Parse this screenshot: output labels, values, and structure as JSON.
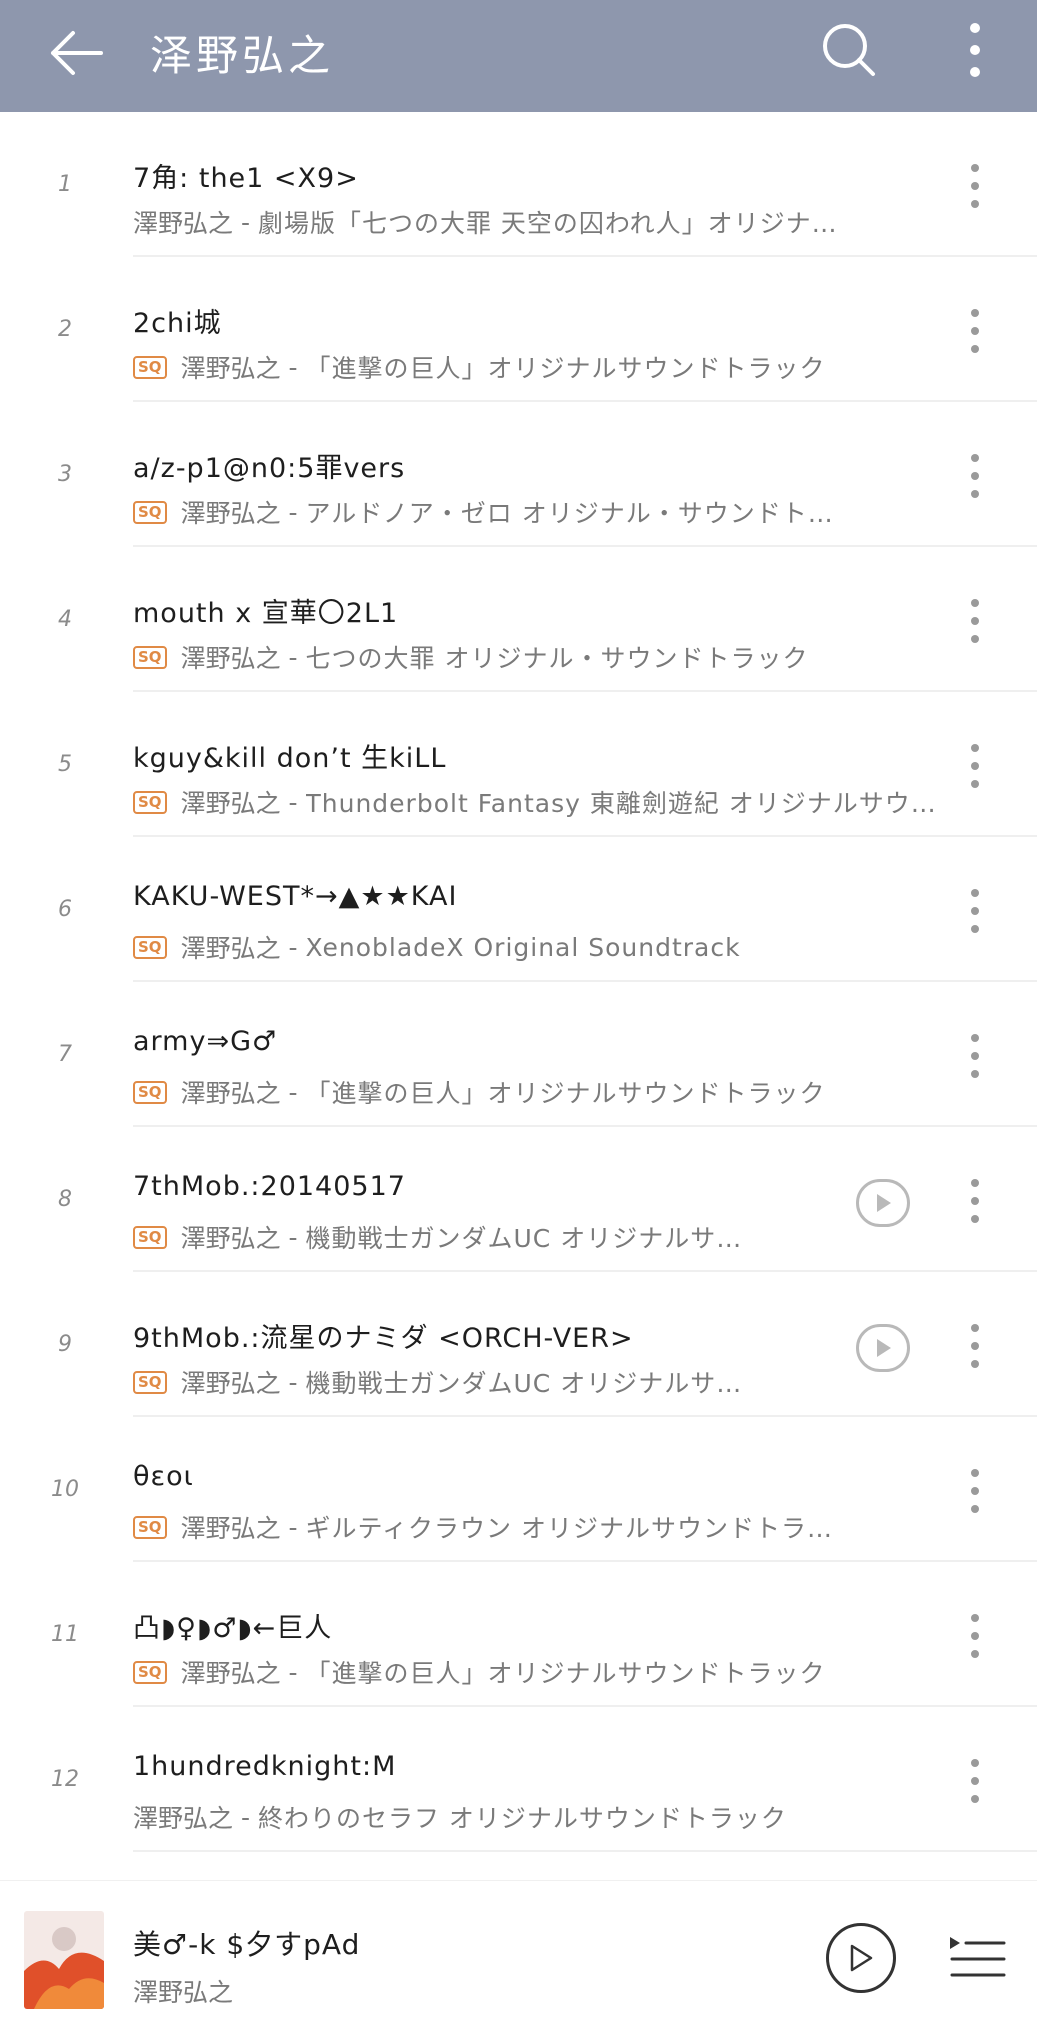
{
  "header": {
    "title": "泽野弘之",
    "back_icon": "arrow-left-icon",
    "search_icon": "search-icon",
    "more_icon": "more-vertical-icon",
    "bg_color": "#8e97ad"
  },
  "tracks": [
    {
      "num": "1",
      "title": "7角: the1 <X9>",
      "sq": false,
      "artist": "澤野弘之",
      "sep": " - ",
      "album": "劇場版「七つの大罪 天空の囚われ人」オリジナ…",
      "play": false
    },
    {
      "num": "2",
      "title": "2chi城",
      "sq": true,
      "sq_label": "SQ",
      "artist": "澤野弘之",
      "sep": " - ",
      "album": "「進撃の巨人」オリジナルサウンドトラック",
      "play": false
    },
    {
      "num": "3",
      "title": "a/z-p1@n0:5罪vers",
      "sq": true,
      "sq_label": "SQ",
      "artist": "澤野弘之",
      "sep": " - ",
      "album": "アルドノア・ゼロ オリジナル・サウンドト…",
      "play": false
    },
    {
      "num": "4",
      "title": "mouth x 宣華〇2L1",
      "sq": true,
      "sq_label": "SQ",
      "artist": "澤野弘之",
      "sep": " - ",
      "album": "七つの大罪 オリジナル・サウンドトラック",
      "play": false
    },
    {
      "num": "5",
      "title": "kguy&kill don’t 生kiLL",
      "sq": true,
      "sq_label": "SQ",
      "artist": "澤野弘之",
      "sep": " - ",
      "album": "Thunderbolt Fantasy 東離劍遊紀 オリジナルサウ…",
      "play": false
    },
    {
      "num": "6",
      "title": "KAKU-WEST*→▲★★KAI",
      "sq": true,
      "sq_label": "SQ",
      "artist": "澤野弘之",
      "sep": " - ",
      "album": "XenobladeX Original Soundtrack",
      "play": false
    },
    {
      "num": "7",
      "title": "army⇒G♂",
      "sq": true,
      "sq_label": "SQ",
      "artist": "澤野弘之",
      "sep": " - ",
      "album": "「進撃の巨人」オリジナルサウンドトラック",
      "play": false
    },
    {
      "num": "8",
      "title": "7thMob.:20140517",
      "sq": true,
      "sq_label": "SQ",
      "artist": "澤野弘之",
      "sep": " - ",
      "album": "機動戦士ガンダムUC オリジナルサ…",
      "play": true
    },
    {
      "num": "9",
      "title": "9thMob.:流星のナミダ <ORCH-VER>",
      "sq": true,
      "sq_label": "SQ",
      "artist": "澤野弘之",
      "sep": " - ",
      "album": "機動戦士ガンダムUC オリジナルサ…",
      "play": true
    },
    {
      "num": "10",
      "title": "θεοι",
      "sq": true,
      "sq_label": "SQ",
      "artist": "澤野弘之",
      "sep": " - ",
      "album": "ギルティクラウン オリジナルサウンドトラ…",
      "play": false
    },
    {
      "num": "11",
      "title": "凸◗♀◗♂◗←巨人",
      "sq": true,
      "sq_label": "SQ",
      "artist": "澤野弘之",
      "sep": " - ",
      "album": "「進撃の巨人」オリジナルサウンドトラック",
      "play": false
    },
    {
      "num": "12",
      "title": "1hundredknight:M",
      "sq": false,
      "artist": "澤野弘之",
      "sep": " - ",
      "album": "終わりのセラフ オリジナルサウンドトラック",
      "play": false
    }
  ],
  "player": {
    "title": "美♂-k $夕すpAd",
    "artist": "澤野弘之",
    "play_icon": "play-circle-icon",
    "playlist_icon": "playlist-icon"
  },
  "colors": {
    "sq_badge": "#e08a45",
    "secondary_text": "#7a7a7a"
  }
}
